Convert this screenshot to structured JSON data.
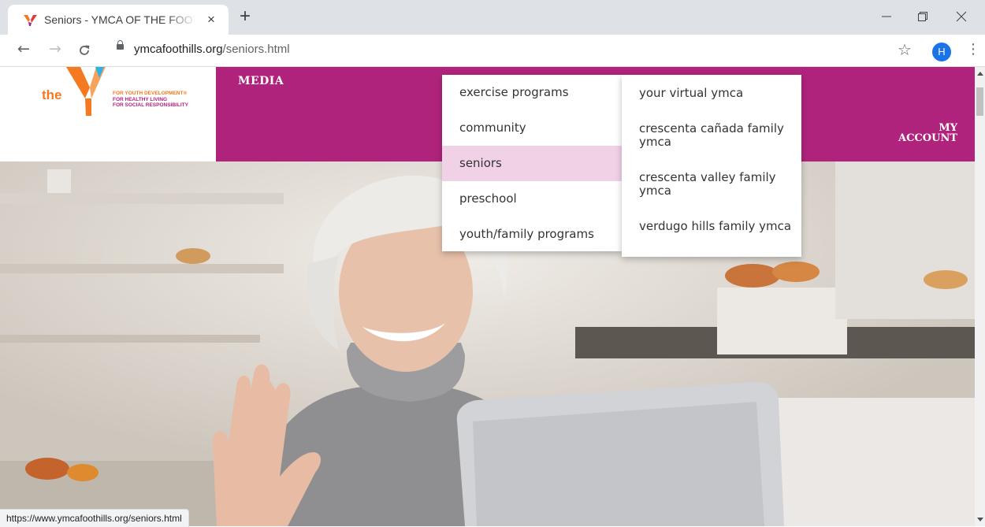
{
  "browser": {
    "tab_title": "Seniors - YMCA OF THE FOOTHILLS",
    "tab_close": "×",
    "new_tab": "+",
    "url_host": "ymcafoothills.org",
    "url_path": "/seniors.html",
    "profile_initial": "H",
    "status_url": "https://www.ymcafoothills.org/seniors.html",
    "brand_colors": {
      "ymca_orange": "#f47920",
      "ymca_magenta": "#b0237c",
      "active_item": "#f1d1e6"
    }
  },
  "site": {
    "logo_word": "the",
    "tagline": [
      "FOR YOUTH DEVELOPMENT®",
      "FOR HEALTHY LIVING",
      "FOR SOCIAL RESPONSIBILITY"
    ],
    "nav_media": "MEDIA",
    "account_line1": "MY",
    "account_line2": "ACCOUNT"
  },
  "menu": {
    "primary": [
      {
        "label": "exercise programs"
      },
      {
        "label": "community"
      },
      {
        "label": "seniors",
        "active": true
      },
      {
        "label": "preschool"
      },
      {
        "label": "youth/family programs"
      }
    ],
    "secondary": [
      {
        "label": "your virtual ymca"
      },
      {
        "label": "crescenta cañada family ymca"
      },
      {
        "label": "crescenta valley family ymca"
      },
      {
        "label": "verdugo hills family ymca"
      }
    ]
  }
}
